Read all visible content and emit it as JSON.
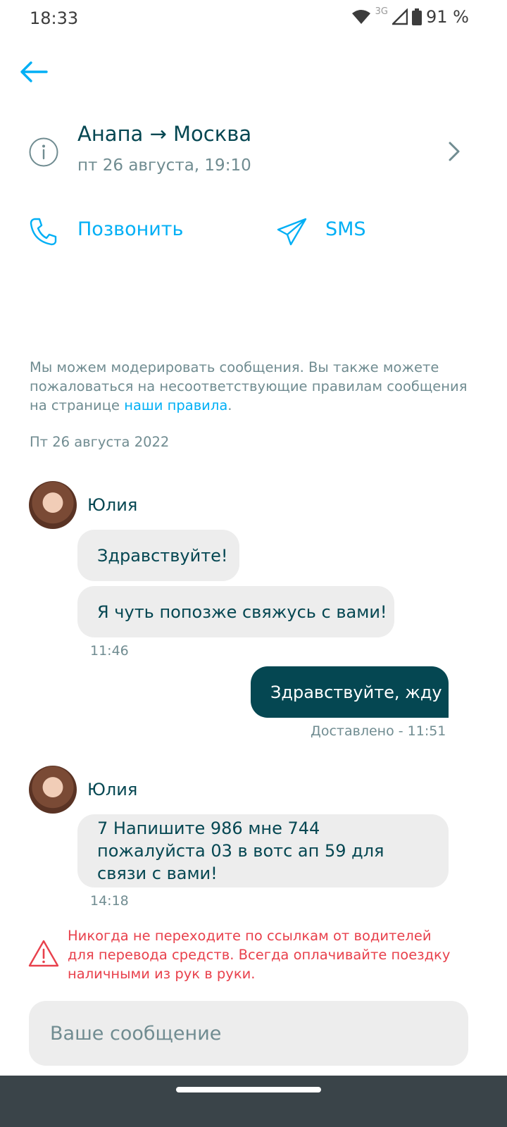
{
  "status_bar": {
    "time": "18:33",
    "network": "3G",
    "battery": "91 %"
  },
  "trip": {
    "route": "Анапа → Москва",
    "datetime": "пт 26 августа, 19:10"
  },
  "actions": {
    "call_label": "Позвонить",
    "sms_label": "SMS"
  },
  "notice": {
    "text": "Мы можем модерировать сообщения. Вы также можете пожаловаться на несоответствующие правилам сообщения на странице ",
    "link_text": "наши правила",
    "suffix": "."
  },
  "date_separator": "Пт 26 августа 2022",
  "messages": [
    {
      "sender": "Юлия",
      "bubbles": [
        "Здравствуйте!",
        "Я чуть попозже свяжусь с вами!"
      ],
      "time": "11:46"
    },
    {
      "outgoing": true,
      "text": "Здравствуйте, жду",
      "status": "Доставлено - 11:51"
    },
    {
      "sender": "Юлия",
      "bubbles": [
        "7 Напишите 986 мне 744 пожалуйста 03 в вотс ап 59 для связи с вами!"
      ],
      "time": "14:18"
    }
  ],
  "warning": "Никогда не переходите по ссылкам от водителей для перевода средств. Всегда оплачивайте поездку наличными из рук в руки.",
  "composer": {
    "placeholder": "Ваше сообщение"
  },
  "colors": {
    "accent": "#00aff5",
    "primary": "#054752",
    "muted": "#708c91",
    "danger": "#e8414c",
    "bubble": "#ededed"
  }
}
